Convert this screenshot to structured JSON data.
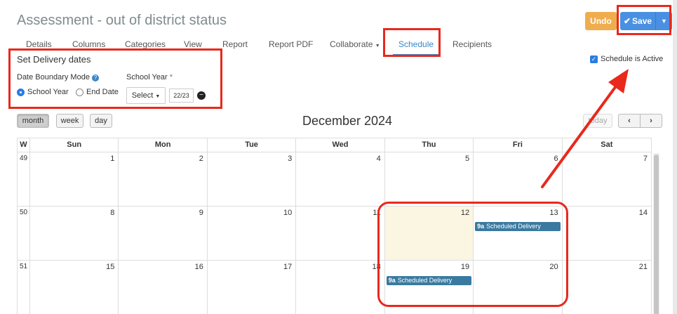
{
  "header": {
    "title": "Assessment - out of district status",
    "undo_label": "Undo",
    "save_label": "Save"
  },
  "tabs": [
    {
      "label": "Details"
    },
    {
      "label": "Columns"
    },
    {
      "label": "Categories"
    },
    {
      "label": "View"
    },
    {
      "label": "Report"
    },
    {
      "label": "Report PDF"
    },
    {
      "label": "Collaborate"
    },
    {
      "label": "Schedule",
      "active": true
    },
    {
      "label": "Recipients"
    }
  ],
  "schedule_form": {
    "section_title": "Set Delivery dates",
    "boundary_mode_label": "Date Boundary Mode",
    "boundary_options": [
      "School Year",
      "End Date"
    ],
    "boundary_selected": "School Year",
    "school_year_label": "School Year",
    "required_mark": "*",
    "select_label": "Select",
    "school_year_value": "22/23",
    "schedule_active_label": "Schedule is Active",
    "schedule_active": true
  },
  "calendar": {
    "view_buttons": [
      "month",
      "week",
      "day"
    ],
    "active_view": "month",
    "title": "December 2024",
    "today_label": "today",
    "prev_icon": "chevron-left-icon",
    "next_icon": "chevron-right-icon",
    "week_header": "W",
    "day_headers": [
      "Sun",
      "Mon",
      "Tue",
      "Wed",
      "Thu",
      "Fri",
      "Sat"
    ],
    "weeks": [
      {
        "week": "49",
        "days": [
          "1",
          "2",
          "3",
          "4",
          "5",
          "6",
          "7"
        ]
      },
      {
        "week": "50",
        "days": [
          "8",
          "9",
          "10",
          "11",
          "12",
          "13",
          "14"
        ]
      },
      {
        "week": "51",
        "days": [
          "15",
          "16",
          "17",
          "18",
          "19",
          "20",
          "21"
        ]
      }
    ],
    "today_date": "12",
    "events": [
      {
        "date": "13",
        "time": "9a",
        "title": "Scheduled Delivery"
      },
      {
        "date": "19",
        "time": "9a",
        "title": "Scheduled Delivery"
      }
    ]
  },
  "colors": {
    "accent": "#3a87c8",
    "undo": "#f0ad4e",
    "save": "#4a90e2",
    "event": "#3a7aa0",
    "today_bg": "#fbf6e1",
    "annotation": "#e8291c"
  }
}
